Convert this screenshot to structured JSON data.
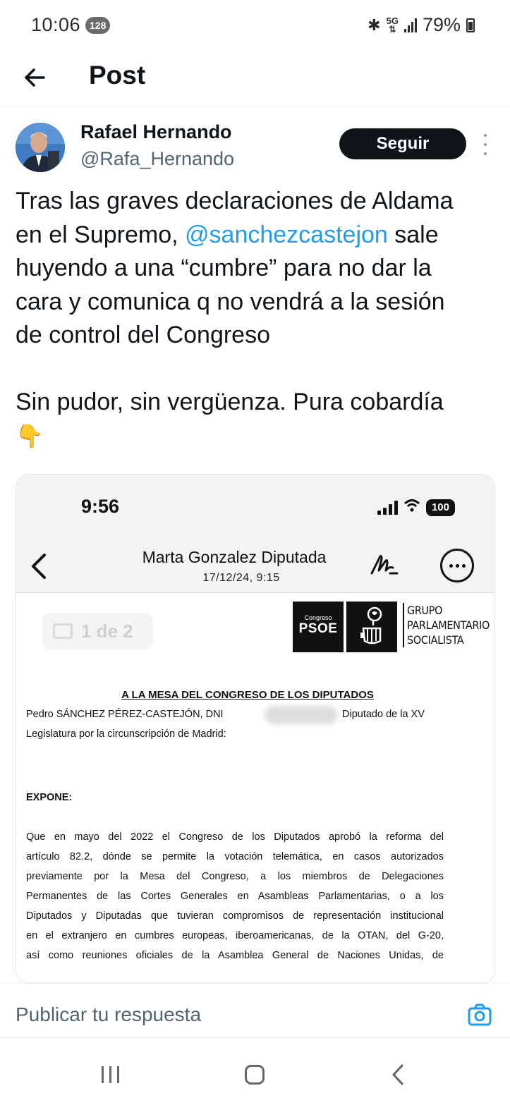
{
  "status_bar": {
    "time": "10:06",
    "notification_badge": "128",
    "network": "5G",
    "battery": "79%"
  },
  "header": {
    "title": "Post"
  },
  "post": {
    "author_name": "Rafael Hernando",
    "author_handle": "@Rafa_Hernando",
    "follow_label": "Seguir",
    "text_lines": [
      "Tras las graves declaraciones de Aldama",
      "en el Supremo, ",
      " sale",
      "huyendo a una “cumbre” para no dar la",
      "cara y comunica q no vendrá a la sesión",
      "de control del Congreso",
      "Sin pudor, sin vergüenza. Pura cobardía"
    ],
    "mention": "@sanchezcastejon",
    "emoji": "👇"
  },
  "embedded_screenshot": {
    "time": "9:56",
    "battery": "100",
    "sender": "Marta Gonzalez Diputada",
    "date": "17/12/24, 9:15",
    "page_indicator": "1 de 2",
    "logo_small": "Congreso",
    "logo_big": "PSOE",
    "group_lines": [
      "GRUPO",
      "PARLAMENTARIO",
      "SOCIALISTA"
    ],
    "heading": "A LA MESA DEL CONGRESO DE LOS DIPUTADOS",
    "para1_a": "Pedro SÁNCHEZ PÉREZ-CASTEJÓN, DNI",
    "para1_b": "Diputado de la XV",
    "para1_c": "Legislatura por la circunscripción de Madrid:",
    "expone": "EXPONE:",
    "body_lines": [
      "Que en mayo del 2022 el Congreso de los Diputados aprobó la reforma del",
      "artículo 82.2, dónde se permite la votación telemática, en casos autorizados",
      "previamente por la Mesa del Congreso, a los miembros de Delegaciones",
      "Permanentes de las Cortes Generales en Asambleas Parlamentarias, o a los",
      "Diputados y Diputadas que tuvieran compromisos de representación institucional",
      "en el extranjero en cumbres europeas, iberoamericanas, de la OTAN, del G-20,",
      "así como reuniones oficiales de la Asamblea General de Naciones Unidas, de"
    ]
  },
  "reply": {
    "placeholder": "Publicar tu respuesta"
  },
  "colors": {
    "mention": "#1d9bf0",
    "follow_bg": "#0f1419",
    "secondary_text": "#536471",
    "camera": "#1d9bf0"
  }
}
